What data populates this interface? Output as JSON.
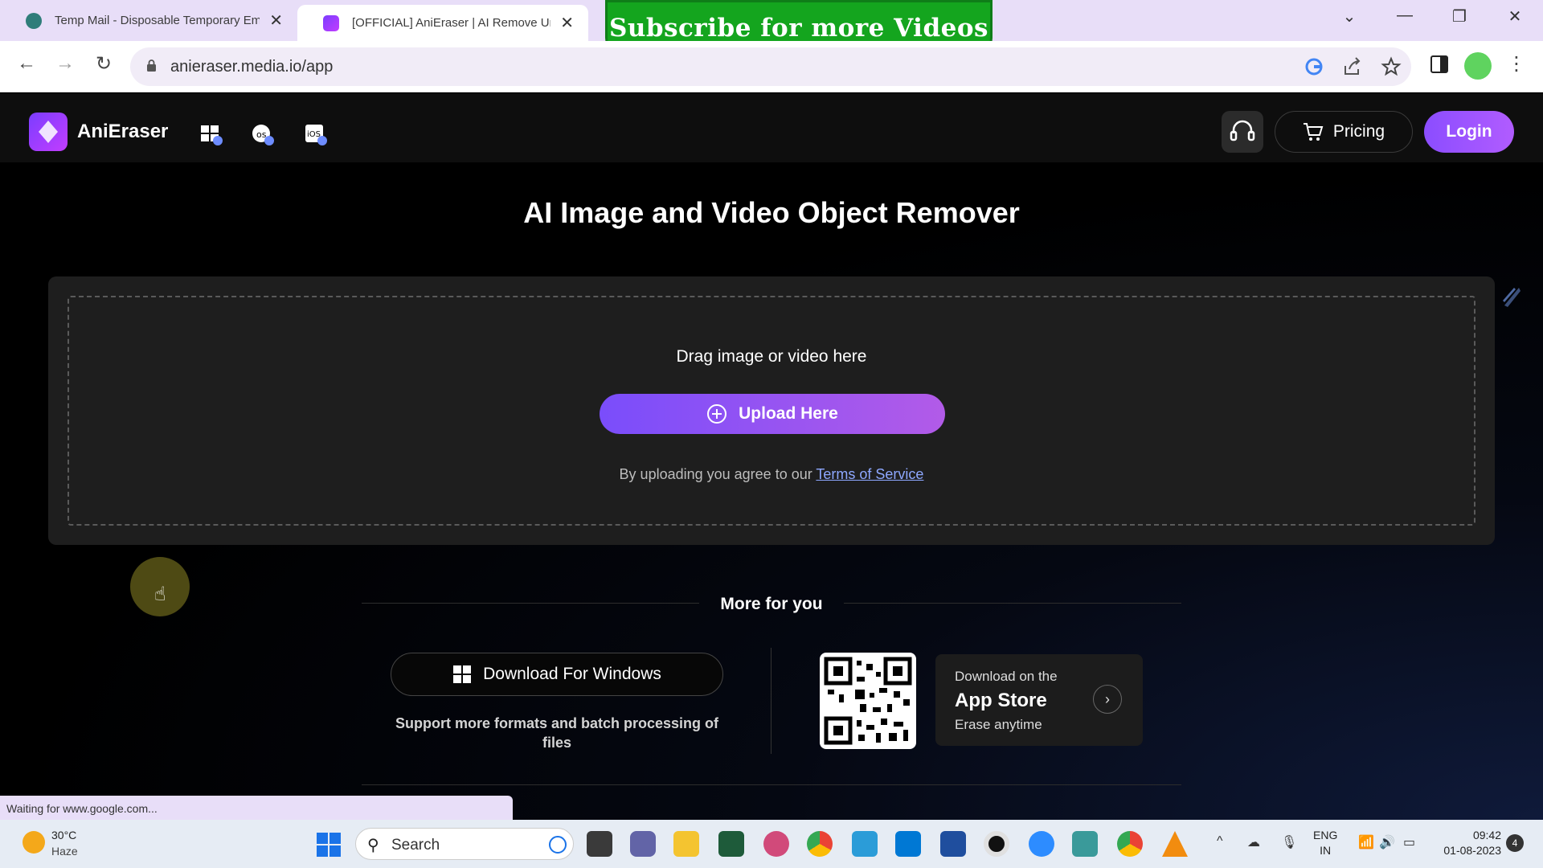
{
  "browser": {
    "tabs": [
      {
        "title": "Temp Mail - Disposable Temporary Ema",
        "active": false
      },
      {
        "title": "[OFFICIAL] AniEraser | AI Remove Unwa",
        "active": true
      }
    ],
    "overlay_banner": "Subscribe for more Videos",
    "url": "anieraser.media.io/app",
    "status_text": "Waiting for www.google.com...",
    "accent_color": "#e8def8"
  },
  "site_header": {
    "logo_text": "AniEraser",
    "platform_icons": [
      "windows-download-icon",
      "mac-download-icon",
      "ios-download-icon"
    ],
    "pricing_label": "Pricing",
    "login_label": "Login",
    "brand_color": "#9b4dff"
  },
  "main": {
    "title": "AI Image and Video Object Remover",
    "drop_text": "Drag image or video here",
    "upload_label": "Upload Here",
    "agree_prefix": "By uploading you agree to our",
    "terms_label": "Terms of Service"
  },
  "more": {
    "title": "More for you",
    "windows_label": "Download For Windows",
    "windows_desc": "Support more formats and batch processing of files",
    "appstore_small": "Download on the",
    "appstore_big": "App Store",
    "appstore_sub": "Erase anytime"
  },
  "taskbar": {
    "temperature": "30°C",
    "condition": "Haze",
    "search_label": "Search",
    "lang_line1": "ENG",
    "lang_line2": "IN",
    "time": "09:42",
    "date": "01-08-2023",
    "notification_count": "4"
  }
}
